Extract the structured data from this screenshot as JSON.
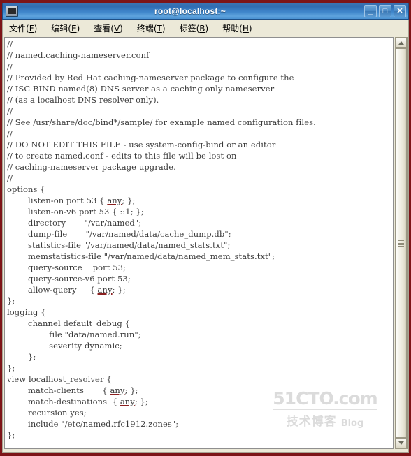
{
  "window": {
    "title": "root@localhost:~",
    "icon": "terminal-icon",
    "frame_color": "#7d1418",
    "titlebar_color": "#3f86cb",
    "controls": [
      {
        "name": "minimize-button",
        "glyph": "_"
      },
      {
        "name": "maximize-button",
        "glyph": "□"
      },
      {
        "name": "close-button",
        "glyph": "✕"
      }
    ]
  },
  "menubar": {
    "items": [
      {
        "name": "menu-file",
        "label": "文件(",
        "mnemonic": "F",
        "close": ")"
      },
      {
        "name": "menu-edit",
        "label": "编辑(",
        "mnemonic": "E",
        "close": ")"
      },
      {
        "name": "menu-view",
        "label": "查看(",
        "mnemonic": "V",
        "close": ")"
      },
      {
        "name": "menu-terminal",
        "label": "终端(",
        "mnemonic": "T",
        "close": ")"
      },
      {
        "name": "menu-tabs",
        "label": "标签(",
        "mnemonic": "B",
        "close": ")"
      },
      {
        "name": "menu-help",
        "label": "帮助(",
        "mnemonic": "H",
        "close": ")"
      }
    ]
  },
  "terminal": {
    "filename": "named.caching-nameserver.conf",
    "misspelled_word": "any",
    "underline_color": "#8b2020",
    "lines": [
      "//",
      "// named.caching-nameserver.conf",
      "//",
      "// Provided by Red Hat caching-nameserver package to configure the",
      "// ISC BIND named(8) DNS server as a caching only nameserver",
      "// (as a localhost DNS resolver only).",
      "//",
      "// See /usr/share/doc/bind*/sample/ for example named configuration files.",
      "//",
      "// DO NOT EDIT THIS FILE - use system-config-bind or an editor",
      "// to create named.conf - edits to this file will be lost on",
      "// caching-nameserver package upgrade.",
      "//",
      "options {",
      "        listen-on port 53 { any; };",
      "        listen-on-v6 port 53 { ::1; };",
      "        directory       \"/var/named\";",
      "        dump-file       \"/var/named/data/cache_dump.db\";",
      "        statistics-file \"/var/named/data/named_stats.txt\";",
      "        memstatistics-file \"/var/named/data/named_mem_stats.txt\";",
      "        query-source    port 53;",
      "        query-source-v6 port 53;",
      "        allow-query     { any; };",
      "};",
      "logging {",
      "        channel default_debug {",
      "                file \"data/named.run\";",
      "                severity dynamic;",
      "        };",
      "};",
      "view localhost_resolver {",
      "        match-clients       { any; };",
      "        match-destinations  { any; };",
      "        recursion yes;",
      "        include \"/etc/named.rfc1912.zones\";",
      "};"
    ]
  },
  "watermark": {
    "top": "51CTO.com",
    "bottom_cn": "技术博客",
    "bottom_en": "Blog"
  },
  "scrollbar": {
    "up_arrow": "scroll-up-arrow",
    "down_arrow": "scroll-down-arrow",
    "thumb": "scrollbar-thumb"
  }
}
